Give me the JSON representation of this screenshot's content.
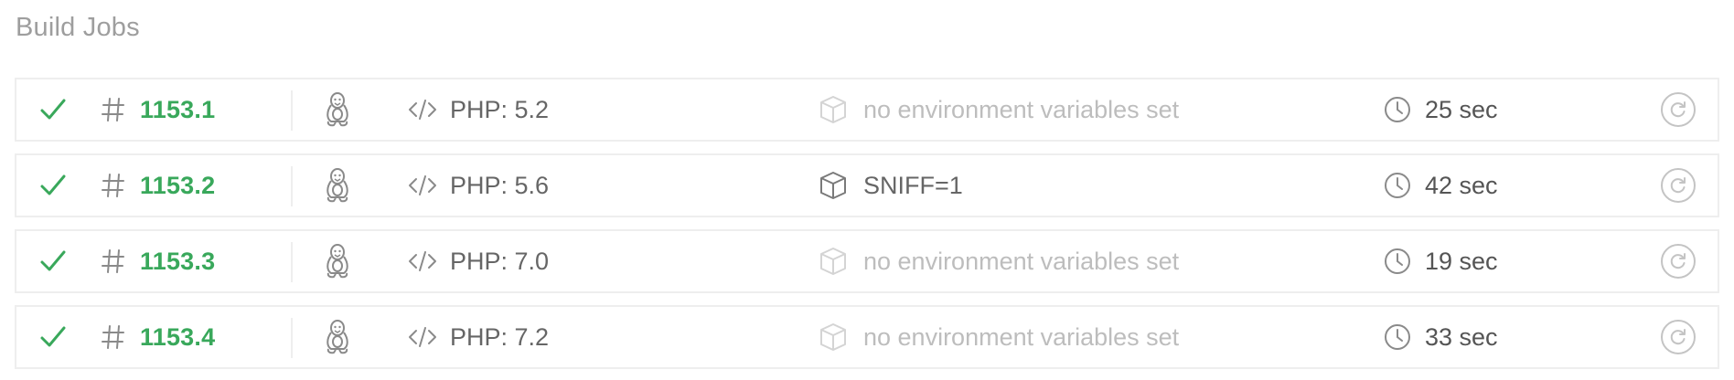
{
  "section": {
    "title": "Build Jobs"
  },
  "colors": {
    "success": "#39a85b",
    "text": "#666666",
    "muted": "#bdbdbd",
    "border": "#eeeeee",
    "icon": "#9e9e9e"
  },
  "icons": {
    "status": "check-icon",
    "number": "hash-icon",
    "os": "linux-tux-icon",
    "language": "code-icon",
    "env": "box-icon",
    "duration": "clock-icon",
    "restart": "restart-icon"
  },
  "jobs": [
    {
      "number": "1153.1",
      "language": "PHP: 5.2",
      "env": "no environment variables set",
      "env_set": false,
      "duration": "25 sec"
    },
    {
      "number": "1153.2",
      "language": "PHP: 5.6",
      "env": "SNIFF=1",
      "env_set": true,
      "duration": "42 sec"
    },
    {
      "number": "1153.3",
      "language": "PHP: 7.0",
      "env": "no environment variables set",
      "env_set": false,
      "duration": "19 sec"
    },
    {
      "number": "1153.4",
      "language": "PHP: 7.2",
      "env": "no environment variables set",
      "env_set": false,
      "duration": "33 sec"
    }
  ]
}
